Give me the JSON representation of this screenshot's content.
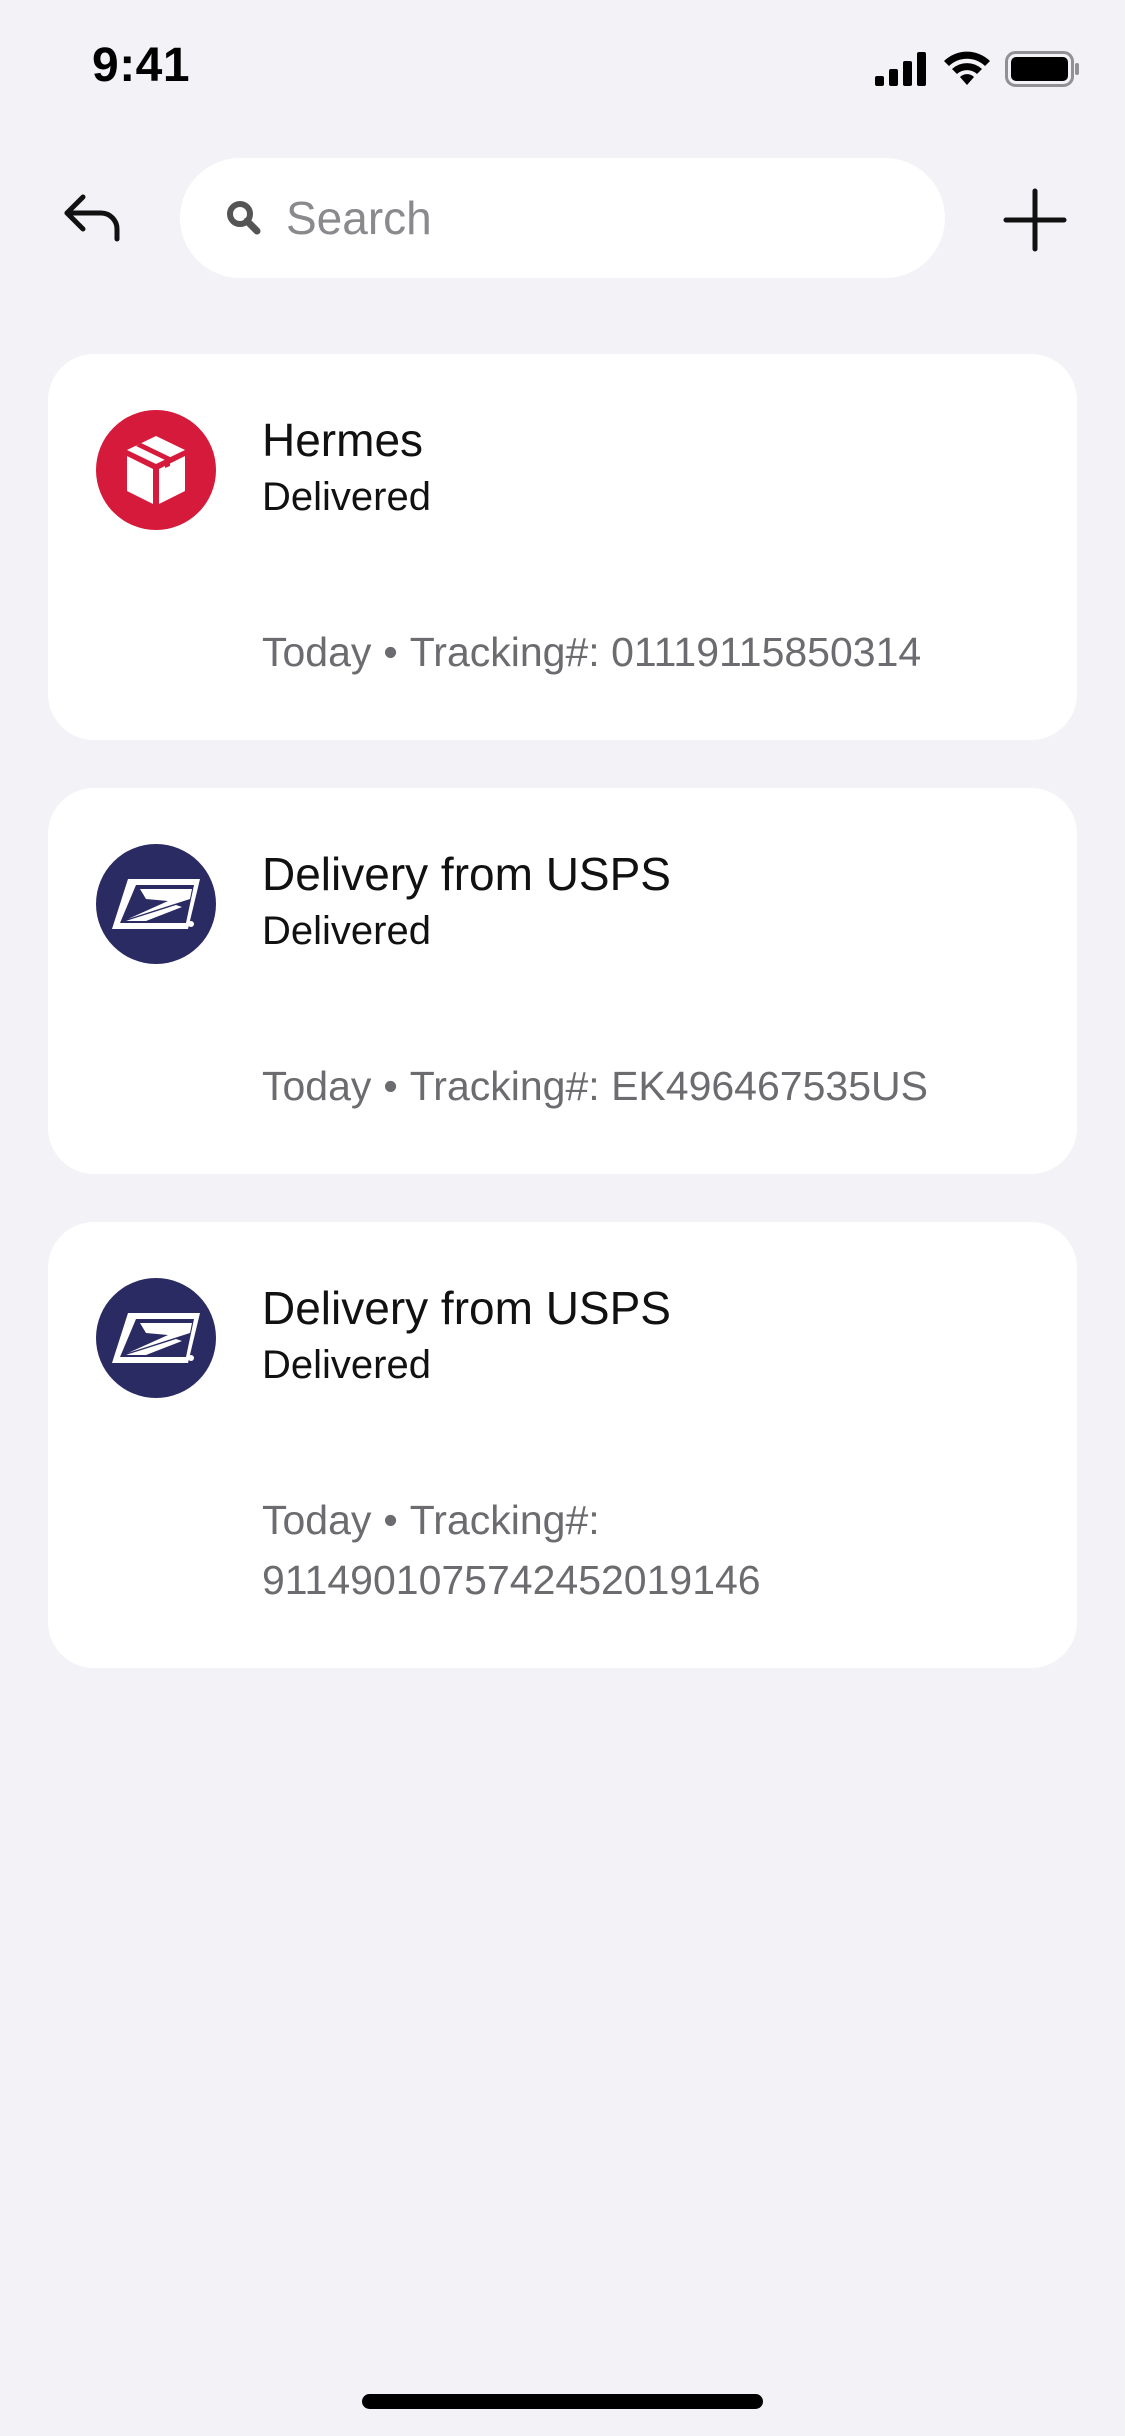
{
  "status_bar": {
    "time": "9:41",
    "icons": [
      "cellular-signal-icon",
      "wifi-icon",
      "battery-icon"
    ]
  },
  "top_bar": {
    "back_icon": "reply-arrow-icon",
    "search": {
      "placeholder": "Search",
      "value": "",
      "icon": "search-icon"
    },
    "add_icon": "plus-icon"
  },
  "deliveries": [
    {
      "carrier_logo": "hermes-logo-icon",
      "title": "Hermes",
      "status": "Delivered",
      "date": "Today",
      "separator": "•",
      "tracking_label": "Tracking#:",
      "tracking_number": "01119115850314"
    },
    {
      "carrier_logo": "usps-logo-icon",
      "title": "Delivery from USPS",
      "status": "Delivered",
      "date": "Today",
      "separator": "•",
      "tracking_label": "Tracking#:",
      "tracking_number": "EK496467535US"
    },
    {
      "carrier_logo": "usps-logo-icon",
      "title": "Delivery from USPS",
      "status": "Delivered",
      "date": "Today",
      "separator": "•",
      "tracking_label": "Tracking#:",
      "tracking_number": "9114901075742452019146"
    }
  ],
  "colors": {
    "background": "#f2f2f7",
    "card": "#ffffff",
    "hermes_red": "#d61a3c",
    "usps_navy": "#2b2b64",
    "secondary_text": "#6c6c70"
  }
}
